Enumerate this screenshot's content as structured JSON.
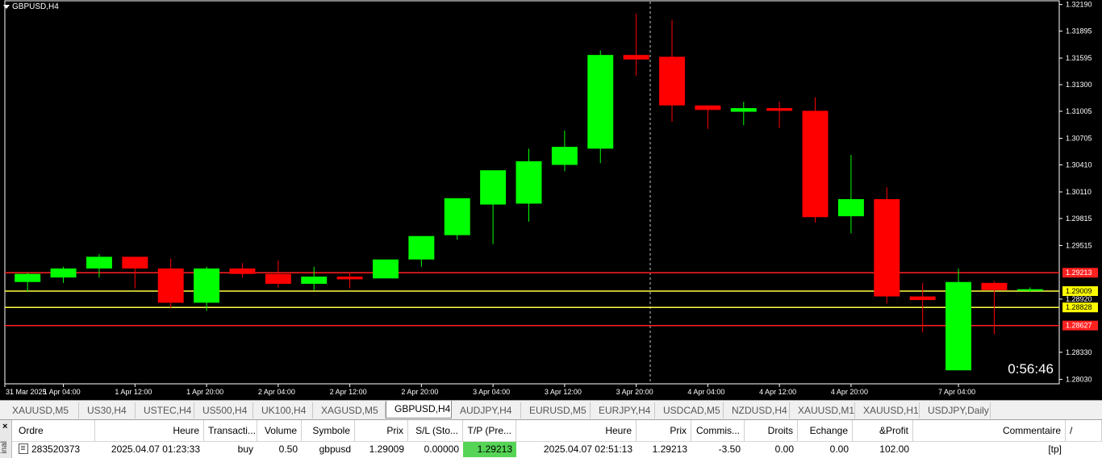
{
  "chart": {
    "symbol_label": "GBPUSD,H4",
    "countdown": "0:56:46",
    "price_levels": [
      "1.32190",
      "1.31895",
      "1.31595",
      "1.31300",
      "1.31005",
      "1.30705",
      "1.30410",
      "1.30110",
      "1.29815",
      "1.29515",
      "1.28920",
      "1.28330",
      "1.28030"
    ],
    "time_labels": [
      "31 Mar 2025",
      "1 Apr 04:00",
      "1 Apr 12:00",
      "1 Apr 20:00",
      "2 Apr 04:00",
      "2 Apr 12:00",
      "2 Apr 20:00",
      "3 Apr 04:00",
      "3 Apr 12:00",
      "3 Apr 20:00",
      "4 Apr 04:00",
      "4 Apr 12:00",
      "4 Apr 20:00",
      "7 Apr 04:00"
    ],
    "horizontal_lines": [
      {
        "price": 1.29213,
        "label": "1.29213",
        "color": "#ff2020",
        "label_bg": "#ff2020",
        "label_color": "#ffffff"
      },
      {
        "price": 1.29009,
        "label": "1.29009",
        "color": "#ffff40",
        "label_bg": "#ffff00",
        "label_color": "#000000"
      },
      {
        "price": 1.28828,
        "label": "1.28828",
        "color": "#ffff40",
        "label_bg": "#ffff00",
        "label_color": "#000000"
      },
      {
        "price": 1.28627,
        "label": "1.28627",
        "color": "#ff2020",
        "label_bg": "#ff2020",
        "label_color": "#ffffff"
      }
    ],
    "colors": {
      "bull": "#00ff00",
      "bear": "#ff0000",
      "background": "#000000",
      "foreground": "#ffffff"
    }
  },
  "chart_data": {
    "type": "candlestick",
    "ylim": [
      1.2798,
      1.3224
    ],
    "candles": [
      {
        "o": 1.2911,
        "h": 1.2921,
        "l": 1.29,
        "c": 1.292
      },
      {
        "o": 1.2916,
        "h": 1.2928,
        "l": 1.291,
        "c": 1.2926
      },
      {
        "o": 1.2926,
        "h": 1.2942,
        "l": 1.2916,
        "c": 1.2939
      },
      {
        "o": 1.2939,
        "h": 1.2939,
        "l": 1.2904,
        "c": 1.2926
      },
      {
        "o": 1.2926,
        "h": 1.2937,
        "l": 1.2882,
        "c": 1.2888
      },
      {
        "o": 1.2888,
        "h": 1.2928,
        "l": 1.2879,
        "c": 1.2926
      },
      {
        "o": 1.2926,
        "h": 1.2932,
        "l": 1.2916,
        "c": 1.292
      },
      {
        "o": 1.292,
        "h": 1.2935,
        "l": 1.2905,
        "c": 1.2909
      },
      {
        "o": 1.2909,
        "h": 1.2928,
        "l": 1.2902,
        "c": 1.2917
      },
      {
        "o": 1.2917,
        "h": 1.2922,
        "l": 1.2904,
        "c": 1.2914
      },
      {
        "o": 1.2915,
        "h": 1.2926,
        "l": 1.2917,
        "c": 1.2936
      },
      {
        "o": 1.2936,
        "h": 1.2961,
        "l": 1.2928,
        "c": 1.2962
      },
      {
        "o": 1.2963,
        "h": 1.2997,
        "l": 1.2958,
        "c": 1.3004
      },
      {
        "o": 1.2997,
        "h": 1.3016,
        "l": 1.2953,
        "c": 1.3035
      },
      {
        "o": 1.2998,
        "h": 1.3059,
        "l": 1.2978,
        "c": 1.3045
      },
      {
        "o": 1.3041,
        "h": 1.3079,
        "l": 1.3034,
        "c": 1.3061
      },
      {
        "o": 1.3059,
        "h": 1.3168,
        "l": 1.3043,
        "c": 1.3163
      },
      {
        "o": 1.3163,
        "h": 1.3209,
        "l": 1.314,
        "c": 1.3158
      },
      {
        "o": 1.3161,
        "h": 1.3202,
        "l": 1.3089,
        "c": 1.3107
      },
      {
        "o": 1.3107,
        "h": 1.3107,
        "l": 1.3081,
        "c": 1.3102
      },
      {
        "o": 1.31,
        "h": 1.3111,
        "l": 1.3085,
        "c": 1.3104
      },
      {
        "o": 1.3104,
        "h": 1.3111,
        "l": 1.3082,
        "c": 1.3101
      },
      {
        "o": 1.3101,
        "h": 1.3116,
        "l": 1.2977,
        "c": 1.2983
      },
      {
        "o": 1.2984,
        "h": 1.3052,
        "l": 1.2965,
        "c": 1.3003
      },
      {
        "o": 1.3003,
        "h": 1.3016,
        "l": 1.2887,
        "c": 1.2895
      },
      {
        "o": 1.2895,
        "h": 1.291,
        "l": 1.2855,
        "c": 1.2891
      },
      {
        "o": 1.2813,
        "h": 1.2926,
        "l": 1.2813,
        "c": 1.2911
      },
      {
        "o": 1.291,
        "h": 1.2912,
        "l": 1.2853,
        "c": 1.2902
      },
      {
        "o": 1.2902,
        "h": 1.2905,
        "l": 1.29,
        "c": 1.2903
      }
    ]
  },
  "tabs": [
    {
      "label": "XAUUSD,M5",
      "active": false
    },
    {
      "label": "US30,H4",
      "active": false
    },
    {
      "label": "USTEC,H4",
      "active": false
    },
    {
      "label": "US500,H4",
      "active": false
    },
    {
      "label": "UK100,H4",
      "active": false
    },
    {
      "label": "XAGUSD,M5",
      "active": false
    },
    {
      "label": "GBPUSD,H4",
      "active": true
    },
    {
      "label": "AUDJPY,H4",
      "active": false
    },
    {
      "label": "EURUSD,M5",
      "active": false
    },
    {
      "label": "EURJPY,H4",
      "active": false
    },
    {
      "label": "USDCAD,M5",
      "active": false
    },
    {
      "label": "NZDUSD,H4",
      "active": false
    },
    {
      "label": "XAUUSD,M1",
      "active": false
    },
    {
      "label": "XAUUSD,H1",
      "active": false
    },
    {
      "label": "USDJPY,Daily",
      "active": false
    }
  ],
  "terminal": {
    "side_label": "inal",
    "close_label": "×",
    "headers": [
      "Ordre",
      "Heure",
      "Transacti...",
      "Volume",
      "Symbole",
      "Prix",
      "S/L (Sto...",
      "T/P (Pre...",
      "Heure",
      "Prix",
      "Commis...",
      "Droits",
      "Echange",
      "&Profit",
      "Commentaire",
      "/"
    ],
    "row": {
      "order": "283520373",
      "open_time": "2025.04.07 01:23:33",
      "type": "buy",
      "volume": "0.50",
      "symbol": "gbpusd",
      "open_price": "1.29009",
      "sl": "0.00000",
      "tp": "1.29213",
      "time": "2025.04.07 02:51:13",
      "price": "1.29213",
      "commission": "-3.50",
      "fees": "0.00",
      "swap": "0.00",
      "profit": "102.00",
      "comment": "[tp]"
    }
  }
}
